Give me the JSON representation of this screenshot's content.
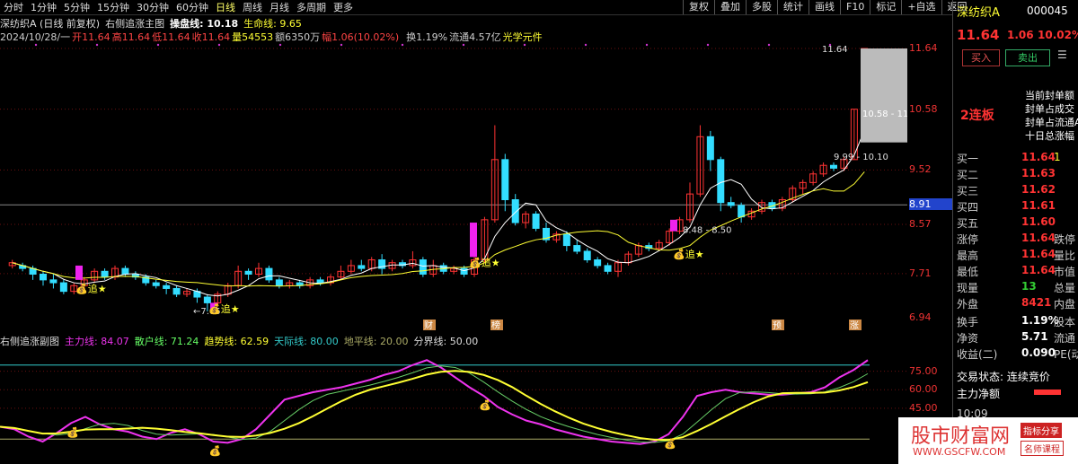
{
  "timeframes": [
    "分时",
    "1分钟",
    "5分钟",
    "15分钟",
    "30分钟",
    "60分钟",
    "日线",
    "周线",
    "月线",
    "多周期",
    "更多"
  ],
  "active_tf": "日线",
  "tools": [
    "复权",
    "叠加",
    "多股",
    "统计",
    "画线",
    "F10",
    "标记",
    "+自选",
    "返回"
  ],
  "info1": {
    "stock": "深纺织A (日线 前复权)",
    "indicator": "右侧追涨主图",
    "cpl": "操盘线: 10.18",
    "sml": "生命线: 9.65"
  },
  "info2": {
    "date": "2024/10/28/一",
    "open": "开11.64",
    "high": "高11.64",
    "low": "低11.64",
    "close": "收11.64",
    "vol": "量54553",
    "amt": "额6350万",
    "pct": "幅1.06(10.02%)",
    "turn": "换1.19%",
    "float": "流通4.57亿",
    "concept": "光学元件"
  },
  "axis_main": [
    "11.64",
    "10.58",
    "9.52",
    "8.91",
    "8.57",
    "7.71",
    "6.94"
  ],
  "annotations": {
    "hi": "11.64",
    "range1": "10.58 - 11",
    "range2": "9.99 - 10.10",
    "range3": "8.48 - 8.50",
    "low": "←7.05",
    "zhui": "追",
    "tags": [
      "财",
      "榜",
      "预",
      "涨"
    ]
  },
  "sub": {
    "title": "右侧追涨副图",
    "l1": "主力线: 84.07",
    "l2": "散户线: 71.24",
    "l3": "趋势线: 62.59",
    "l4": "天际线: 80.00",
    "l5": "地平线: 20.00",
    "l6": "分界线: 50.00"
  },
  "axis_sub": [
    "75.00",
    "60.00",
    "45.00"
  ],
  "right": {
    "name": "深纺织A",
    "code": "000045",
    "price": "11.64",
    "chg": "1.06",
    "pct": "10.02%",
    "buy": "买入",
    "sell": "卖出",
    "lianban": "2连板",
    "notes": [
      "当前封单额",
      "封单占成交",
      "封单占流通A",
      "十日总涨幅"
    ],
    "book": [
      [
        "买一",
        "11.64",
        "1"
      ],
      [
        "买二",
        "11.63",
        ""
      ],
      [
        "买三",
        "11.62",
        ""
      ],
      [
        "买四",
        "11.61",
        ""
      ],
      [
        "买五",
        "11.60",
        ""
      ]
    ],
    "stats": [
      [
        "涨停",
        "11.64",
        "跌停"
      ],
      [
        "最高",
        "11.64",
        "量比"
      ],
      [
        "最低",
        "11.64",
        "市值"
      ],
      [
        "现量",
        "13",
        "总量"
      ],
      [
        "外盘",
        "8421",
        "内盘"
      ]
    ],
    "stats2": [
      [
        "换手",
        "1.19%",
        "股本"
      ],
      [
        "净资",
        "5.71",
        "流通"
      ],
      [
        "收益(二)",
        "0.090",
        "PE(动"
      ]
    ],
    "state": "交易状态: 连续竞价",
    "flow": "主力净额",
    "time": "10:09"
  },
  "watermark": {
    "cn": "股市财富网",
    "url": "WWW.GSCFW.COM",
    "b1": "指标分享",
    "b2": "名师课程"
  },
  "chart_data": {
    "type": "candlestick",
    "ylim": [
      6.94,
      11.64
    ],
    "candles": [
      [
        7.85,
        7.9,
        7.95,
        7.8
      ],
      [
        7.85,
        7.8,
        7.9,
        7.75
      ],
      [
        7.8,
        7.7,
        7.85,
        7.6
      ],
      [
        7.7,
        7.6,
        7.75,
        7.5
      ],
      [
        7.6,
        7.55,
        7.7,
        7.45
      ],
      [
        7.55,
        7.4,
        7.6,
        7.35
      ],
      [
        7.4,
        7.5,
        7.55,
        7.35
      ],
      [
        7.5,
        7.6,
        7.65,
        7.45
      ],
      [
        7.6,
        7.75,
        7.8,
        7.55
      ],
      [
        7.75,
        7.65,
        7.8,
        7.6
      ],
      [
        7.65,
        7.8,
        7.85,
        7.6
      ],
      [
        7.8,
        7.7,
        7.85,
        7.65
      ],
      [
        7.7,
        7.65,
        7.75,
        7.6
      ],
      [
        7.65,
        7.55,
        7.7,
        7.5
      ],
      [
        7.55,
        7.5,
        7.6,
        7.45
      ],
      [
        7.5,
        7.45,
        7.55,
        7.35
      ],
      [
        7.45,
        7.35,
        7.5,
        7.3
      ],
      [
        7.35,
        7.4,
        7.45,
        7.3
      ],
      [
        7.4,
        7.3,
        7.45,
        7.2
      ],
      [
        7.3,
        7.2,
        7.35,
        7.05
      ],
      [
        7.2,
        7.35,
        7.4,
        7.15
      ],
      [
        7.35,
        7.5,
        7.55,
        7.3
      ],
      [
        7.5,
        7.75,
        7.85,
        7.45
      ],
      [
        7.75,
        7.7,
        7.8,
        7.6
      ],
      [
        7.7,
        7.8,
        7.9,
        7.65
      ],
      [
        7.8,
        7.6,
        7.85,
        7.55
      ],
      [
        7.6,
        7.5,
        7.65,
        7.45
      ],
      [
        7.5,
        7.55,
        7.6,
        7.45
      ],
      [
        7.55,
        7.5,
        7.6,
        7.45
      ],
      [
        7.5,
        7.6,
        7.65,
        7.45
      ],
      [
        7.6,
        7.55,
        7.65,
        7.5
      ],
      [
        7.55,
        7.65,
        7.7,
        7.5
      ],
      [
        7.65,
        7.75,
        7.85,
        7.6
      ],
      [
        7.75,
        7.85,
        7.95,
        7.7
      ],
      [
        7.85,
        7.8,
        7.95,
        7.75
      ],
      [
        7.8,
        7.95,
        8.0,
        7.75
      ],
      [
        7.95,
        7.8,
        8.05,
        7.7
      ],
      [
        7.8,
        7.9,
        7.95,
        7.75
      ],
      [
        7.9,
        7.85,
        7.95,
        7.8
      ],
      [
        7.85,
        7.95,
        8.1,
        7.8
      ],
      [
        7.95,
        7.7,
        8.0,
        7.65
      ],
      [
        7.7,
        7.85,
        7.95,
        7.65
      ],
      [
        7.85,
        7.75,
        7.9,
        7.7
      ],
      [
        7.75,
        7.8,
        7.85,
        7.7
      ],
      [
        7.8,
        7.7,
        7.85,
        7.65
      ],
      [
        7.7,
        7.95,
        8.0,
        7.65
      ],
      [
        7.95,
        8.65,
        8.7,
        7.9
      ],
      [
        8.65,
        9.7,
        10.3,
        8.6
      ],
      [
        9.7,
        9.0,
        9.8,
        8.8
      ],
      [
        9.0,
        8.6,
        9.1,
        8.55
      ],
      [
        8.6,
        8.75,
        8.8,
        8.5
      ],
      [
        8.75,
        8.5,
        8.8,
        8.45
      ],
      [
        8.5,
        8.3,
        8.6,
        8.25
      ],
      [
        8.3,
        8.4,
        8.45,
        8.25
      ],
      [
        8.4,
        8.2,
        8.45,
        8.1
      ],
      [
        8.2,
        8.1,
        8.3,
        8.05
      ],
      [
        8.1,
        7.95,
        8.15,
        7.9
      ],
      [
        7.95,
        7.85,
        8.0,
        7.8
      ],
      [
        7.85,
        7.75,
        7.9,
        7.7
      ],
      [
        7.75,
        7.9,
        7.95,
        7.65
      ],
      [
        7.9,
        8.05,
        8.1,
        7.85
      ],
      [
        8.05,
        8.2,
        8.25,
        8.0
      ],
      [
        8.2,
        8.15,
        8.25,
        8.1
      ],
      [
        8.15,
        8.25,
        8.3,
        8.1
      ],
      [
        8.25,
        8.45,
        8.5,
        8.2
      ],
      [
        8.45,
        8.65,
        8.7,
        8.4
      ],
      [
        8.65,
        9.1,
        9.3,
        8.6
      ],
      [
        9.1,
        10.1,
        10.3,
        9.05
      ],
      [
        10.1,
        9.7,
        10.2,
        9.5
      ],
      [
        9.7,
        8.95,
        9.75,
        8.8
      ],
      [
        8.95,
        8.9,
        9.05,
        8.85
      ],
      [
        8.9,
        8.7,
        8.95,
        8.6
      ],
      [
        8.7,
        8.8,
        8.85,
        8.65
      ],
      [
        8.8,
        8.95,
        9.0,
        8.75
      ],
      [
        8.95,
        8.85,
        9.0,
        8.8
      ],
      [
        8.85,
        9.0,
        9.05,
        8.8
      ],
      [
        9.0,
        9.2,
        9.25,
        8.95
      ],
      [
        9.2,
        9.3,
        9.35,
        9.1
      ],
      [
        9.3,
        9.45,
        9.5,
        9.25
      ],
      [
        9.45,
        9.6,
        9.65,
        9.4
      ],
      [
        9.6,
        9.55,
        9.65,
        9.5
      ],
      [
        9.55,
        9.7,
        9.75,
        9.5
      ],
      [
        9.7,
        10.58,
        10.58,
        9.7
      ],
      [
        10.58,
        11.64,
        11.64,
        11.64
      ]
    ]
  }
}
